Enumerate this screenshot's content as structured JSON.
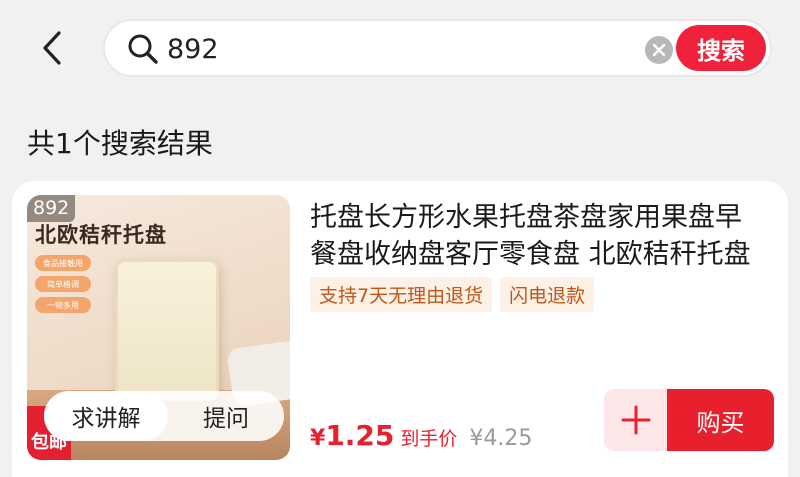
{
  "header": {
    "back_icon": "chevron-left-icon",
    "search": {
      "value": "892",
      "placeholder": "",
      "button_label": "搜索"
    }
  },
  "results": {
    "count_label": "共1个搜索结果"
  },
  "product": {
    "image": {
      "corner_tag": "892",
      "overlay_title": "北欧秸秆托盘",
      "feature_pills": [
        "食品接触用",
        "简单格调",
        "一物多用"
      ],
      "badge_text": "包邮"
    },
    "live_actions": {
      "ask_label": "求讲解",
      "question_label": "提问"
    },
    "title": "托盘长方形水果托盘茶盘家用果盘早餐盘收纳盘客厅零食盘 北欧秸秆托盘",
    "tags": [
      "支持7天无理由退货",
      "闪电退款"
    ],
    "price": {
      "symbol": "¥",
      "value": "1.25",
      "label": "到手价",
      "original": "¥4.25"
    },
    "buy_label": "购买"
  },
  "colors": {
    "accent_red": "#e8202e",
    "search_button": "#f0213b",
    "tag_text": "#c0561a",
    "tag_bg": "#fdf1e6",
    "page_bg": "#f1f1f1"
  }
}
